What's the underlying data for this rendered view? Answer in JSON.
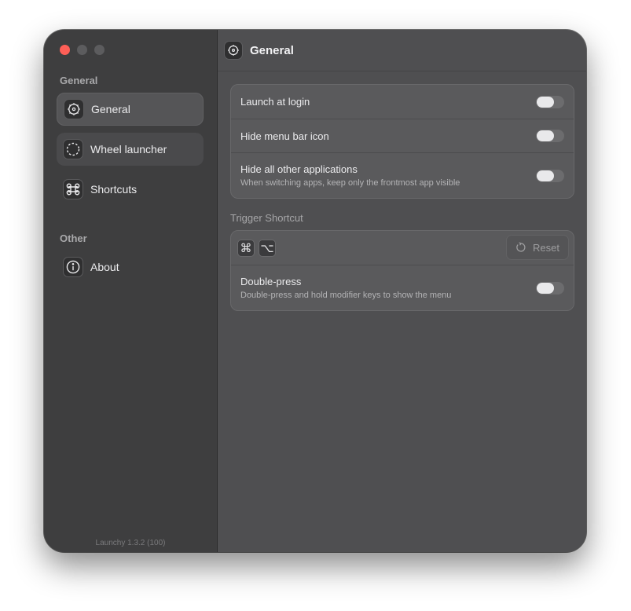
{
  "sidebar": {
    "section_general": "General",
    "section_other": "Other",
    "items": [
      {
        "label": "General",
        "icon": "gear-icon"
      },
      {
        "label": "Wheel launcher",
        "icon": "dashed-circle-icon"
      },
      {
        "label": "Shortcuts",
        "icon": "command-icon"
      },
      {
        "label": "About",
        "icon": "info-icon"
      }
    ],
    "version": "Launchy 1.3.2 (100)"
  },
  "header": {
    "title": "General",
    "icon": "gear-icon"
  },
  "general_settings": [
    {
      "title": "Launch at login",
      "subtitle": "",
      "enabled": false
    },
    {
      "title": "Hide menu bar icon",
      "subtitle": "",
      "enabled": false
    },
    {
      "title": "Hide all other applications",
      "subtitle": "When switching apps, keep only the frontmost app visible",
      "enabled": false
    }
  ],
  "trigger": {
    "label": "Trigger Shortcut",
    "keys": [
      "⌘",
      "⌥"
    ],
    "reset_label": "Reset",
    "double_press_title": "Double-press",
    "double_press_subtitle": "Double-press and hold modifier keys to show the menu",
    "double_press_enabled": false
  },
  "colors": {
    "close": "#fe5f57",
    "window": "#4f4f51",
    "sidebar": "#3e3e3f"
  }
}
